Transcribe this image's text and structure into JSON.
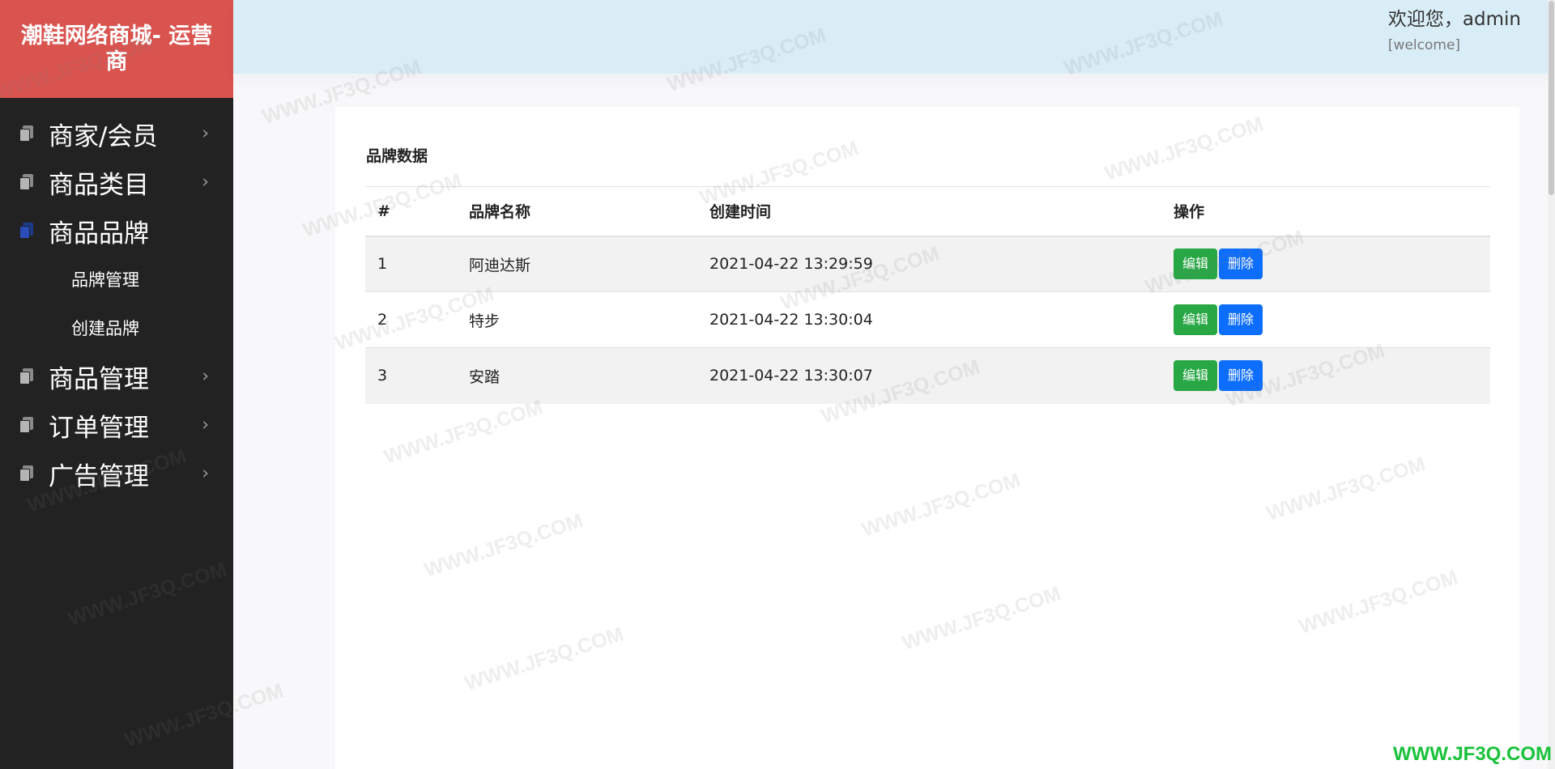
{
  "app": {
    "brand_title": "潮鞋网络商城- 运营商"
  },
  "sidebar": {
    "items": [
      {
        "label": "商家/会员",
        "icon": "document-icon",
        "chevron": "›"
      },
      {
        "label": "商品类目",
        "icon": "document-icon",
        "chevron": "›"
      },
      {
        "label": "商品品牌",
        "icon": "document-icon",
        "active": true
      },
      {
        "label": "商品管理",
        "icon": "document-icon",
        "chevron": "›"
      },
      {
        "label": "订单管理",
        "icon": "document-icon",
        "chevron": "›"
      },
      {
        "label": "广告管理",
        "icon": "document-icon",
        "chevron": "›"
      }
    ],
    "submenu": [
      {
        "label": "品牌管理"
      },
      {
        "label": "创建品牌"
      }
    ]
  },
  "header": {
    "welcome": "欢迎您，admin",
    "welcome_sub": "[welcome]"
  },
  "main": {
    "panel_title": "品牌数据",
    "columns": [
      "#",
      "品牌名称",
      "创建时间",
      "操作"
    ],
    "rows": [
      {
        "id": "1",
        "name": "阿迪达斯",
        "created": "2021-04-22 13:29:59",
        "edit": "编辑",
        "delete": "删除"
      },
      {
        "id": "2",
        "name": "特步",
        "created": "2021-04-22 13:30:04",
        "edit": "编辑",
        "delete": "删除"
      },
      {
        "id": "3",
        "name": "安踏",
        "created": "2021-04-22 13:30:07",
        "edit": "编辑",
        "delete": "删除"
      }
    ]
  },
  "watermark": {
    "text": "WWW.JF3Q.COM",
    "bottom_text": "WWW.JF3Q.COM"
  },
  "colors": {
    "sidebar_bg": "#222222",
    "brand_bg": "#d9534f",
    "header_bg": "#d9edf7",
    "edit_button": "#28a745",
    "delete_button": "#0d6efd",
    "active_icon": "#284db8",
    "watermark_green": "#19c23a"
  }
}
